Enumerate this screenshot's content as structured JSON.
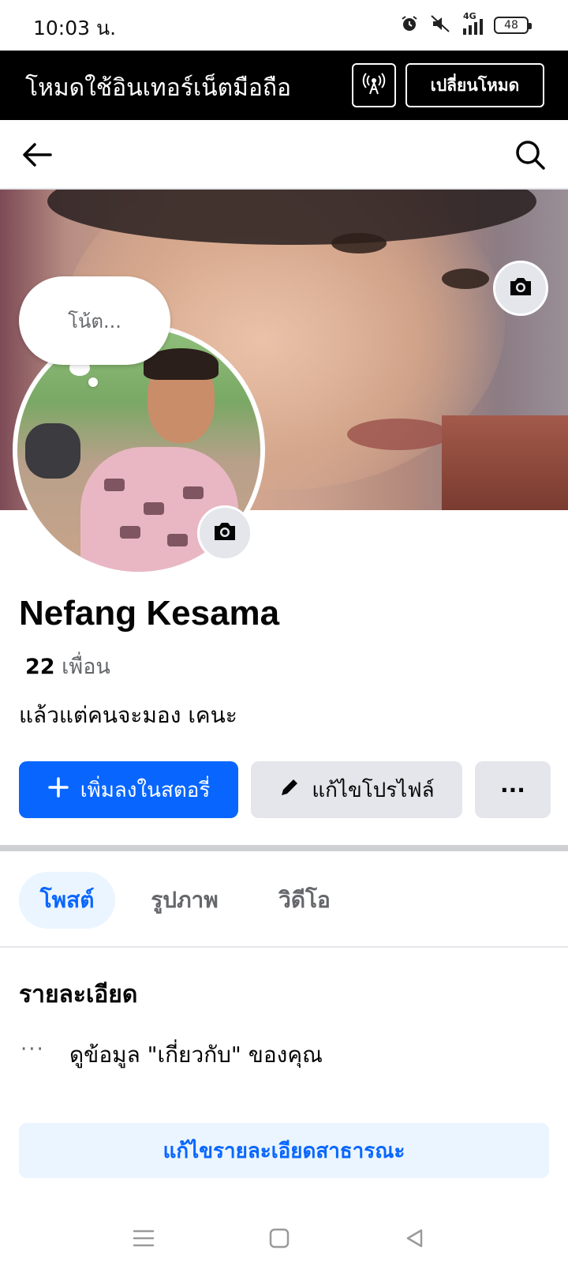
{
  "status_bar": {
    "time": "10:03 น.",
    "network": "4G",
    "battery": "48",
    "icons": [
      "alarm-icon",
      "mute-icon",
      "signal-icon",
      "battery-icon"
    ]
  },
  "data_banner": {
    "text": "โหมดใช้อินเทอร์เน็ตมือถือ",
    "switch_label": "เปลี่ยนโหมด",
    "icon": "antenna-icon"
  },
  "top_nav": {
    "icons": [
      "back-arrow-icon",
      "search-icon"
    ]
  },
  "cover": {
    "camera_icon": "camera-icon"
  },
  "note": {
    "placeholder": "โน้ต..."
  },
  "profile": {
    "name": "Nefang Kesama",
    "friends_count": "22",
    "friends_label": "เพื่อน",
    "bio": "แล้วแต่คนจะมอง เคนะ"
  },
  "actions": {
    "add_story": "เพิ่มลงในสตอรี่",
    "edit_profile": "แก้ไขโปรไฟล์",
    "more": "···"
  },
  "tabs": [
    {
      "label": "โพสต์",
      "active": true
    },
    {
      "label": "รูปภาพ",
      "active": false
    },
    {
      "label": "วิดีโอ",
      "active": false
    }
  ],
  "details": {
    "title": "รายละเอียด",
    "about_text": "ดูข้อมูล \"เกี่ยวกับ\" ของคุณ",
    "more_icon": "···",
    "edit_button": "แก้ไขรายละเอียดสาธารณะ"
  },
  "system_nav": {
    "icons": [
      "menu-icon",
      "home-square-icon",
      "back-triangle-icon"
    ]
  },
  "colors": {
    "accent": "#0866ff",
    "accent_light": "#ebf5ff",
    "secondary_button": "#e4e6eb",
    "banner_bg": "#000000",
    "text_secondary": "#65676b"
  }
}
